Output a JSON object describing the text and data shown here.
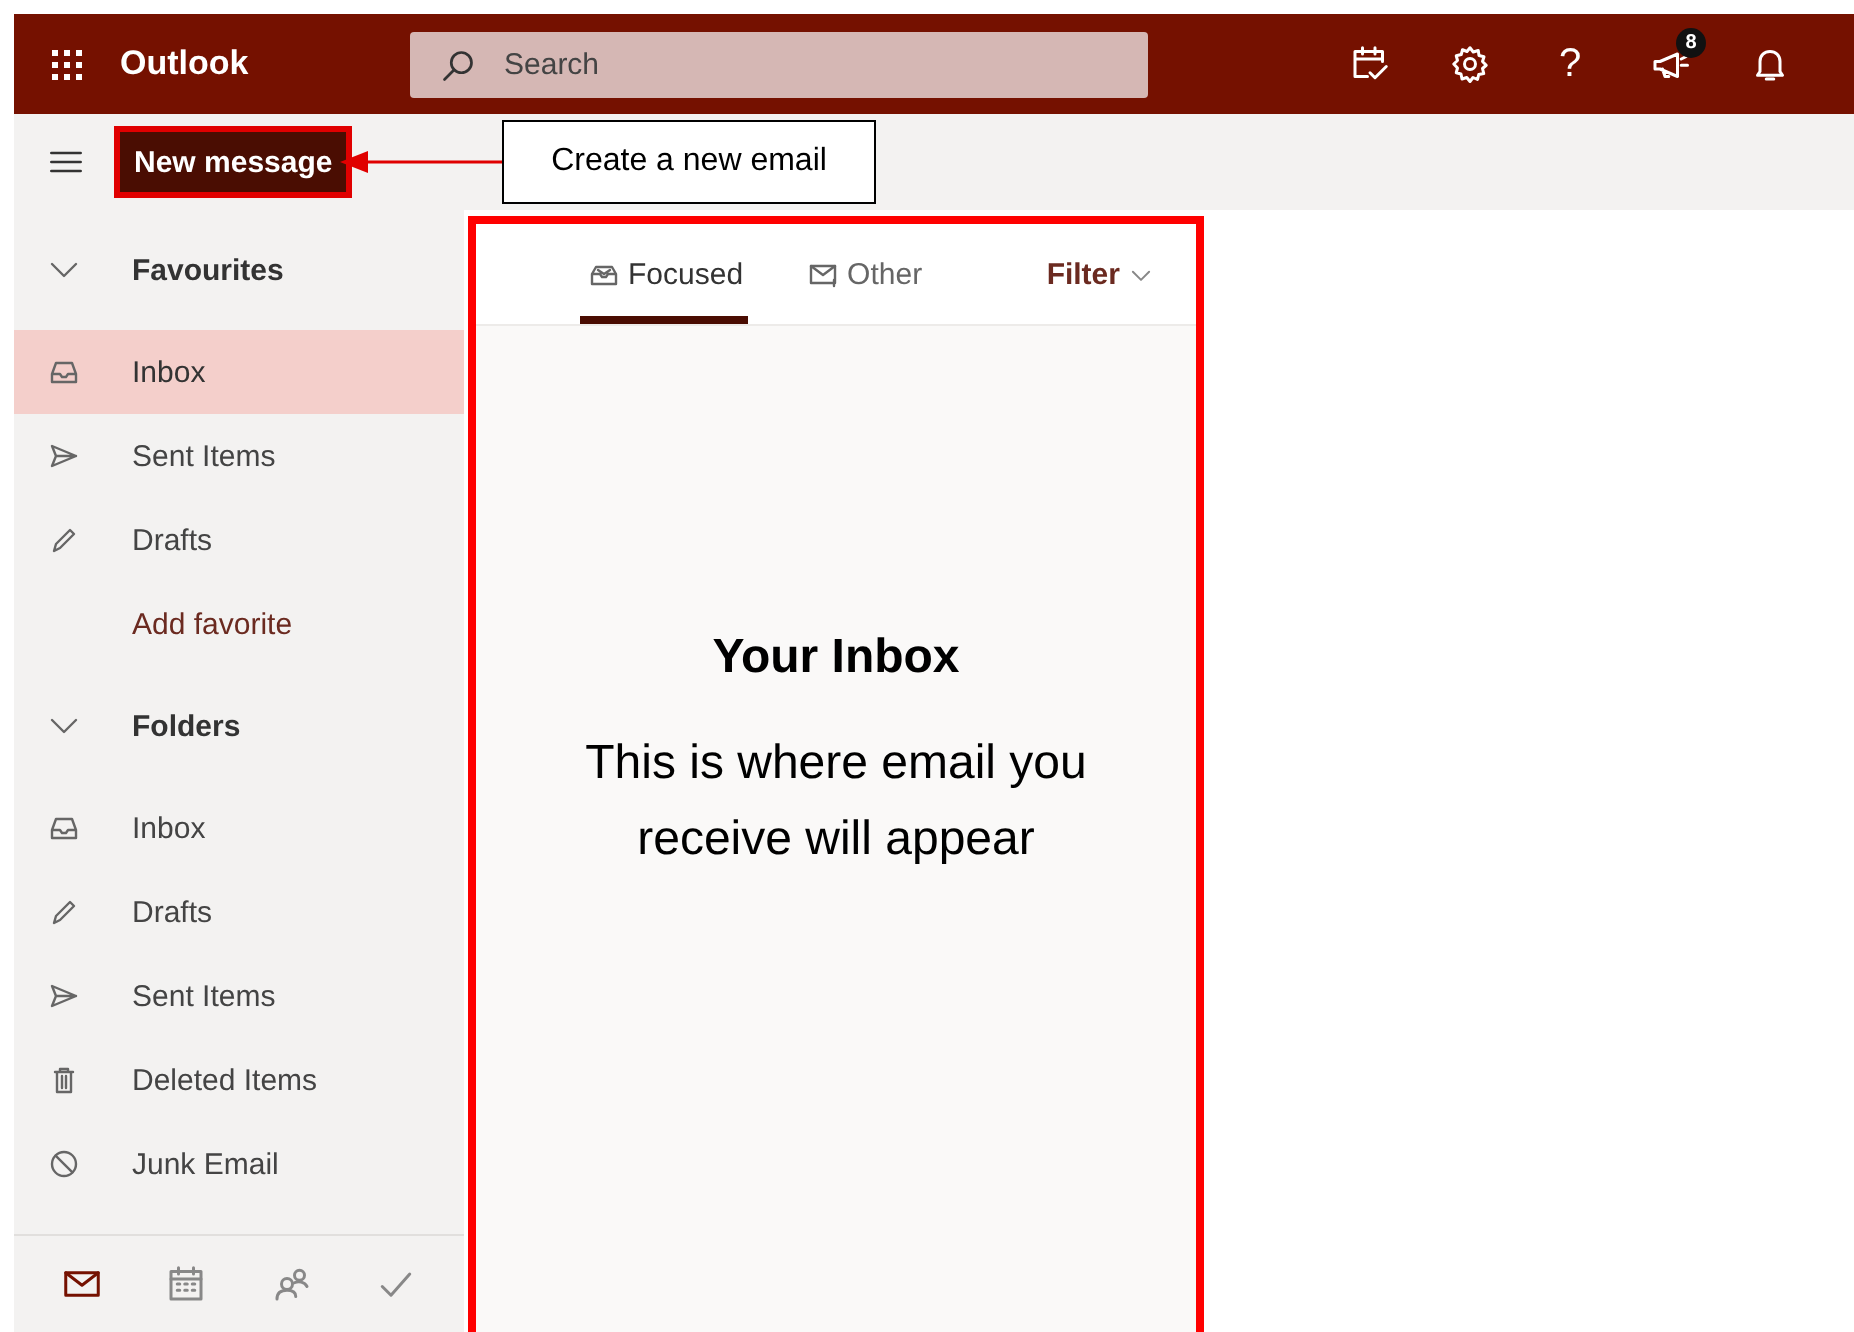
{
  "app_bar": {
    "app_name": "Outlook",
    "search": {
      "placeholder": "Search"
    },
    "help": "?",
    "notification_badge": "8"
  },
  "command_bar": {
    "new_message": "New message",
    "callout": "Create a new email"
  },
  "sidebar": {
    "sections": [
      {
        "title": "Favourites",
        "expanded": true,
        "items": [
          {
            "label": "Inbox",
            "kind": "inbox",
            "selected": true
          },
          {
            "label": "Sent Items",
            "kind": "sent",
            "selected": false
          },
          {
            "label": "Drafts",
            "kind": "drafts",
            "selected": false
          },
          {
            "label": "Add favorite",
            "kind": "action",
            "selected": false
          }
        ]
      },
      {
        "title": "Folders",
        "expanded": true,
        "items": [
          {
            "label": "Inbox",
            "kind": "inbox",
            "selected": false
          },
          {
            "label": "Drafts",
            "kind": "drafts",
            "selected": false
          },
          {
            "label": "Sent Items",
            "kind": "sent",
            "selected": false
          },
          {
            "label": "Deleted Items",
            "kind": "deleted",
            "selected": false
          },
          {
            "label": "Junk Email",
            "kind": "junk",
            "selected": false
          }
        ]
      }
    ],
    "bottom_nav": [
      {
        "kind": "mail",
        "selected": true
      },
      {
        "kind": "calendar",
        "selected": false
      },
      {
        "kind": "people",
        "selected": false
      },
      {
        "kind": "tasks",
        "selected": false
      }
    ]
  },
  "mail_list": {
    "tabs": [
      {
        "label": "Focused",
        "kind": "focused",
        "selected": true
      },
      {
        "label": "Other",
        "kind": "other",
        "selected": false
      }
    ],
    "filter": "Filter",
    "empty_state": {
      "title": "Your Inbox",
      "message": "This is where email you receive will appear"
    }
  }
}
